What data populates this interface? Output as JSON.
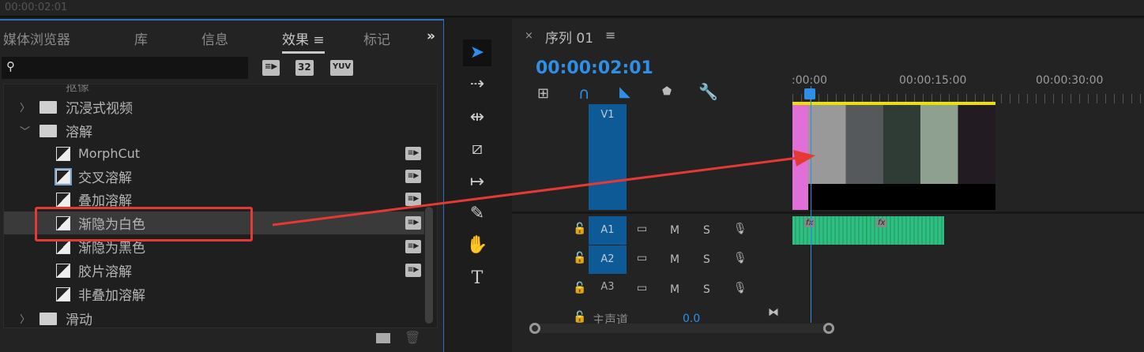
{
  "top_bar": {
    "timecode": "00:00:02:01"
  },
  "effects_panel": {
    "tabs": [
      "媒体浏览器",
      "库",
      "信息",
      "效果",
      "标记"
    ],
    "active_tab": "效果",
    "overflow": "»",
    "search": {
      "value": "",
      "placeholder": ""
    },
    "filter_badges": [
      "accelerated",
      "32",
      "YUV"
    ],
    "items": [
      {
        "type": "folder-partial",
        "label": "抠像",
        "expanded": false
      },
      {
        "type": "folder",
        "label": "沉浸式视频",
        "expanded": false
      },
      {
        "type": "folder",
        "label": "溶解",
        "expanded": true
      },
      {
        "type": "effect",
        "label": "MorphCut",
        "accelerated": true
      },
      {
        "type": "effect",
        "label": "交叉溶解",
        "accelerated": true,
        "default": true
      },
      {
        "type": "effect",
        "label": "叠加溶解",
        "accelerated": true
      },
      {
        "type": "effect",
        "label": "渐隐为白色",
        "accelerated": true,
        "selected": true,
        "highlighted": true
      },
      {
        "type": "effect",
        "label": "渐隐为黑色",
        "accelerated": true
      },
      {
        "type": "effect",
        "label": "胶片溶解",
        "accelerated": true
      },
      {
        "type": "effect",
        "label": "非叠加溶解",
        "accelerated": false
      },
      {
        "type": "folder",
        "label": "滑动",
        "expanded": false
      }
    ]
  },
  "timeline": {
    "sequence_title": "序列 01",
    "close": "×",
    "menu": "≡",
    "timecode": "00:00:02:01",
    "ruler_labels": [
      ":00:00",
      "00:00:15:00",
      "00:00:30:00"
    ],
    "video_tracks": [
      {
        "name": "V1"
      }
    ],
    "audio_tracks": [
      {
        "name": "A1"
      },
      {
        "name": "A2"
      },
      {
        "name": "A3"
      }
    ],
    "track_buttons": {
      "mute": "M",
      "solo": "S"
    },
    "master": {
      "label": "主声道",
      "value": "0.0"
    },
    "fx_badge": "fx"
  },
  "colors": {
    "accent": "#2f8fe6",
    "highlight_box": "#e53935",
    "arrow": "#e53935",
    "audio_clip": "#2fbf80",
    "work_area": "#f0e000",
    "clip_pink": "#e070d8"
  }
}
